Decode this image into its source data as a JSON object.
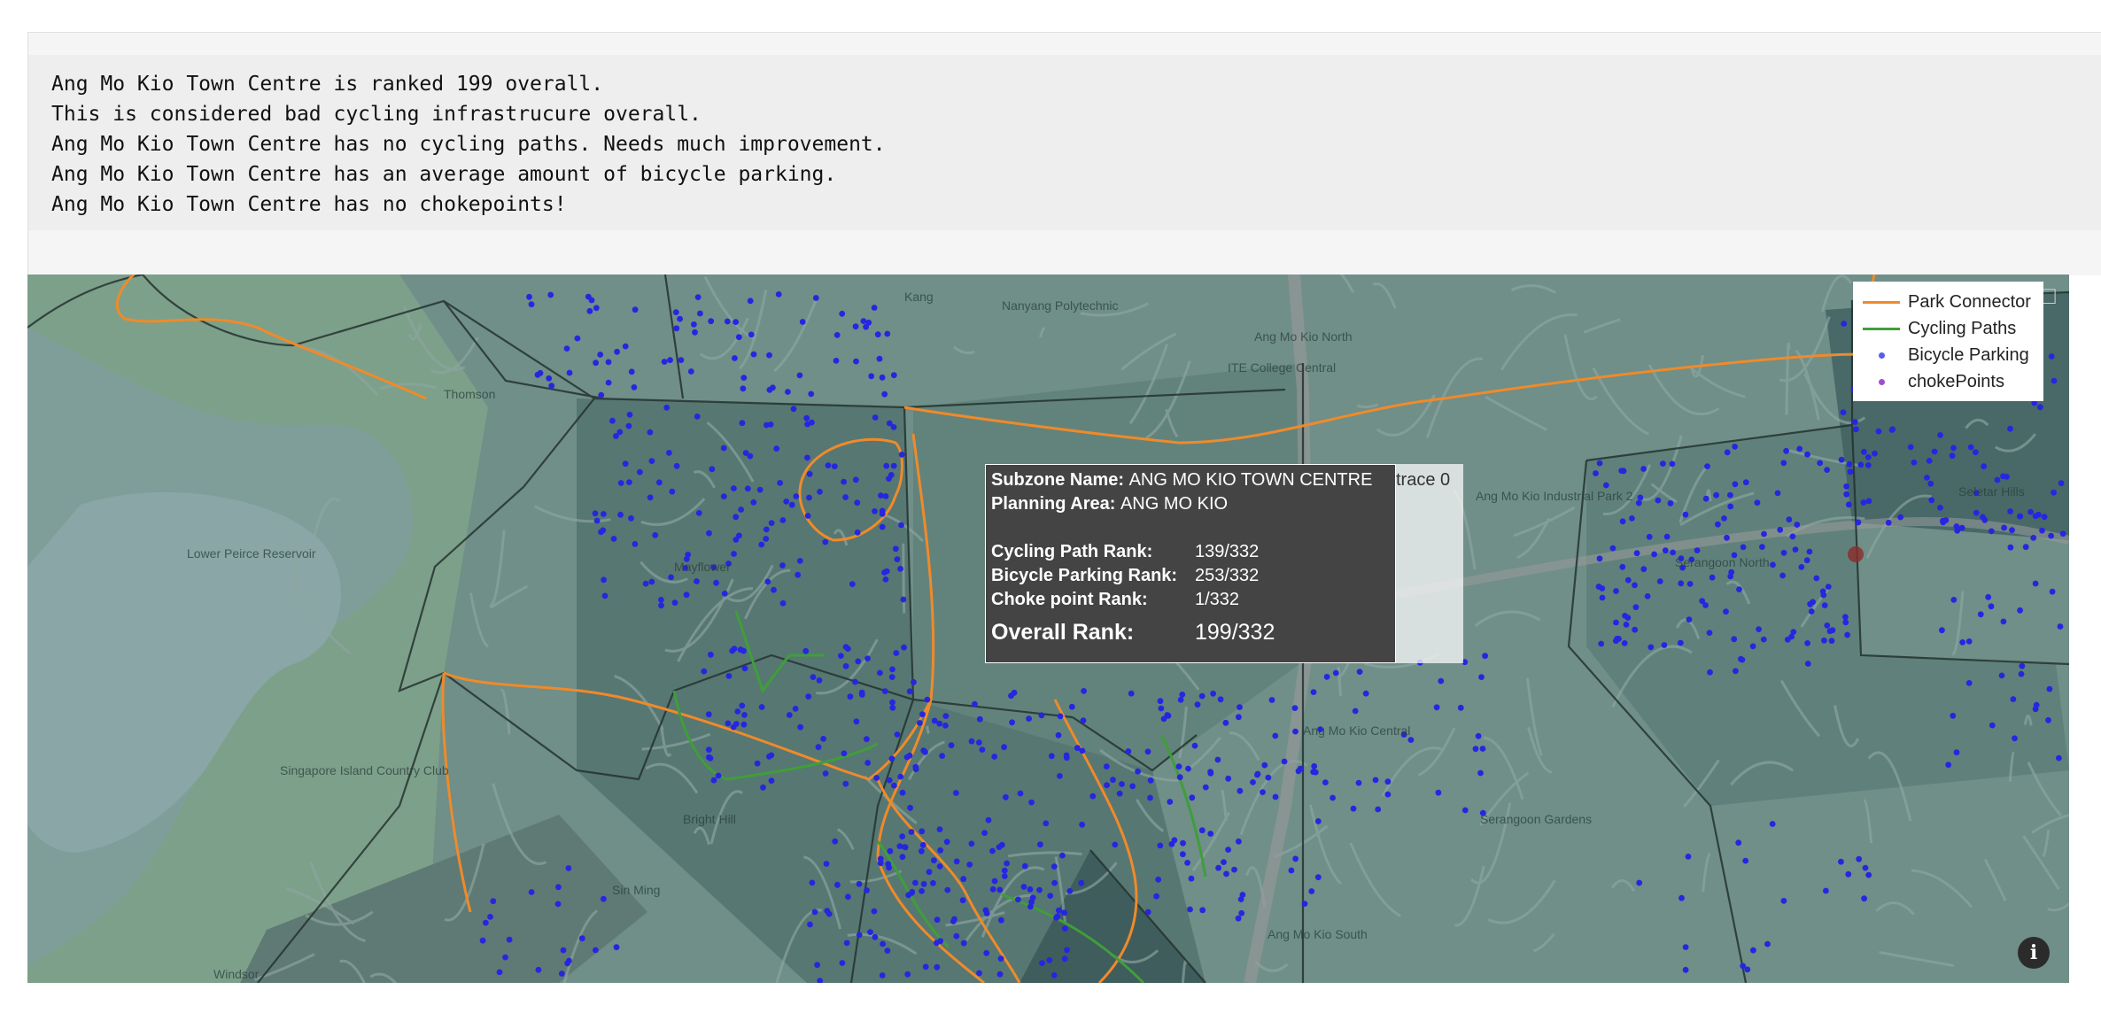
{
  "output": {
    "lines": [
      "Ang Mo Kio Town Centre is ranked 199 overall.",
      "This is considered bad cycling infrastrucure overall.",
      "Ang Mo Kio Town Centre has no cycling paths. Needs much improvement.",
      "Ang Mo Kio Town Centre has an average amount of bicycle parking.",
      "Ang Mo Kio Town Centre has no chokepoints!"
    ]
  },
  "legend": {
    "items": [
      {
        "label": "Park Connector",
        "color": "#f08a2a",
        "kind": "line"
      },
      {
        "label": "Cycling Paths",
        "color": "#3f9e3a",
        "kind": "line"
      },
      {
        "label": "Bicycle Parking",
        "color": "#5b5bf0",
        "kind": "dot"
      },
      {
        "label": "chokePoints",
        "color": "#9b4fd0",
        "kind": "dot"
      }
    ]
  },
  "hover": {
    "subzone_label": "Subzone Name:",
    "subzone_value": "ANG MO KIO TOWN CENTRE",
    "planning_label": "Planning Area:",
    "planning_value": "ANG MO KIO",
    "cycling_label": "Cycling Path Rank:",
    "cycling_value": "139/332",
    "parking_label": "Bicycle Parking Rank:",
    "parking_value": "253/332",
    "choke_label": "Choke point Rank:",
    "choke_value": "1/332",
    "overall_label": "Overall Rank:",
    "overall_value": "199/332",
    "trace": "trace 0"
  },
  "map": {
    "place_labels": [
      "Lower Peirce Reservoir",
      "Singapore Island Country Club",
      "Thomson",
      "Nanyang Polytechnic",
      "Ang Mo Kio North",
      "ITE College Central",
      "Ang Mo Kio Industrial Park 2",
      "Serangoon North",
      "Ang Mo Kio Central",
      "Serangoon Gardens",
      "Bright Hill",
      "Sin Ming",
      "Windsor",
      "Ang Mo Kio South",
      "Seletar Hills",
      "Kang",
      "Mayflower"
    ]
  },
  "modebar": {
    "icons": [
      "camera-icon",
      "pan-icon",
      "select-icon",
      "comment-icon"
    ]
  },
  "info": {
    "glyph": "i"
  }
}
